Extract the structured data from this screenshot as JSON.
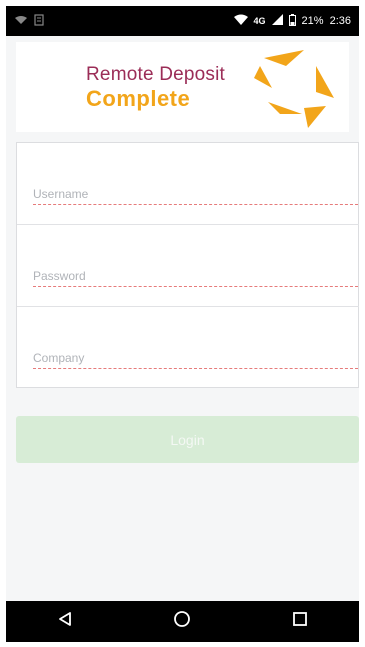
{
  "status_bar": {
    "network": "4G",
    "battery": "21%",
    "time": "2:36"
  },
  "brand": {
    "line1": "Remote Deposit",
    "line2": "Complete",
    "colors": {
      "primary": "#9b2d57",
      "accent": "#f2a51a"
    }
  },
  "form": {
    "username_placeholder": "Username",
    "password_placeholder": "Password",
    "company_placeholder": "Company"
  },
  "login": {
    "label": "Login",
    "color": "#d7ecd6"
  },
  "nav": {
    "back_icon": "back-triangle-icon",
    "home_icon": "home-circle-icon",
    "recents_icon": "recents-square-icon"
  }
}
